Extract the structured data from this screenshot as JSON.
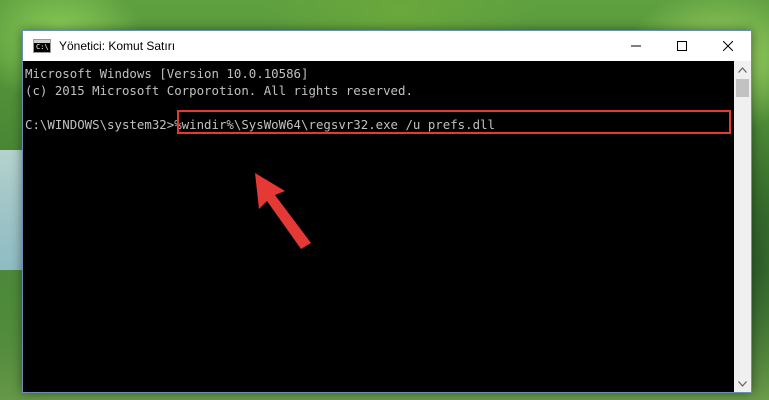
{
  "window": {
    "title": "Yönetici: Komut Satırı",
    "icon_glyph": "C:\\",
    "controls": {
      "minimize_icon": "minimize-icon",
      "maximize_icon": "maximize-icon",
      "close_icon": "close-icon"
    }
  },
  "console": {
    "lines": [
      "Microsoft Windows [Version 10.0.10586]",
      "(c) 2015 Microsoft Corporotion. All rights reserved."
    ],
    "prompt": "C:\\WINDOWS\\system32>",
    "command": "%windir%\\SysWoW64\\regsvr32.exe /u prefs.dll"
  },
  "annotation": {
    "highlight_color": "#e53935",
    "arrow_color": "#e53935"
  }
}
